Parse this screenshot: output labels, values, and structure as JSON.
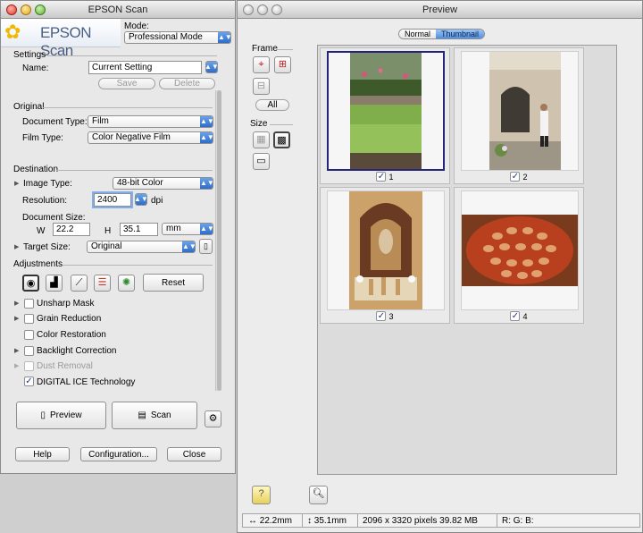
{
  "scan_window": {
    "title": "EPSON Scan",
    "brand": "EPSON Scan",
    "mode_label": "Mode:",
    "mode_value": "Professional Mode",
    "settings": {
      "heading": "Settings",
      "name_label": "Name:",
      "name_value": "Current Setting",
      "save_label": "Save",
      "delete_label": "Delete"
    },
    "original": {
      "heading": "Original",
      "document_type_label": "Document Type:",
      "document_type_value": "Film",
      "film_type_label": "Film Type:",
      "film_type_value": "Color Negative Film"
    },
    "destination": {
      "heading": "Destination",
      "image_type_label": "Image Type:",
      "image_type_value": "48-bit Color",
      "resolution_label": "Resolution:",
      "resolution_value": "2400",
      "resolution_unit": "dpi",
      "document_size_label": "Document Size:",
      "width_label": "W",
      "width_value": "22.2",
      "height_label": "H",
      "height_value": "35.1",
      "unit_value": "mm",
      "target_size_label": "Target Size:",
      "target_size_value": "Original"
    },
    "adjustments": {
      "heading": "Adjustments",
      "reset_label": "Reset",
      "items": [
        {
          "label": "Unsharp Mask",
          "checked": false,
          "disabled": false
        },
        {
          "label": "Grain Reduction",
          "checked": false,
          "disabled": false
        },
        {
          "label": "Color Restoration",
          "checked": false,
          "disabled": false
        },
        {
          "label": "Backlight Correction",
          "checked": false,
          "disabled": false
        },
        {
          "label": "Dust Removal",
          "checked": false,
          "disabled": true
        },
        {
          "label": "DIGITAL ICE Technology",
          "checked": true,
          "disabled": false
        }
      ]
    },
    "preview_label": "Preview",
    "scan_label": "Scan",
    "help_label": "Help",
    "configuration_label": "Configuration...",
    "close_label": "Close"
  },
  "preview_window": {
    "title": "Preview",
    "tabs": [
      "Normal",
      "Thumbnail"
    ],
    "active_tab": "Thumbnail",
    "frame_label": "Frame",
    "all_label": "All",
    "size_label": "Size",
    "thumbnails": [
      {
        "number": "1",
        "checked": true,
        "selected": true
      },
      {
        "number": "2",
        "checked": true,
        "selected": false
      },
      {
        "number": "3",
        "checked": true,
        "selected": false
      },
      {
        "number": "4",
        "checked": true,
        "selected": false
      }
    ],
    "status": {
      "width": "22.2mm",
      "height": "35.1mm",
      "pixels": "2096 x 3320 pixels 39.82 MB",
      "rgb": "R: G: B:"
    }
  }
}
